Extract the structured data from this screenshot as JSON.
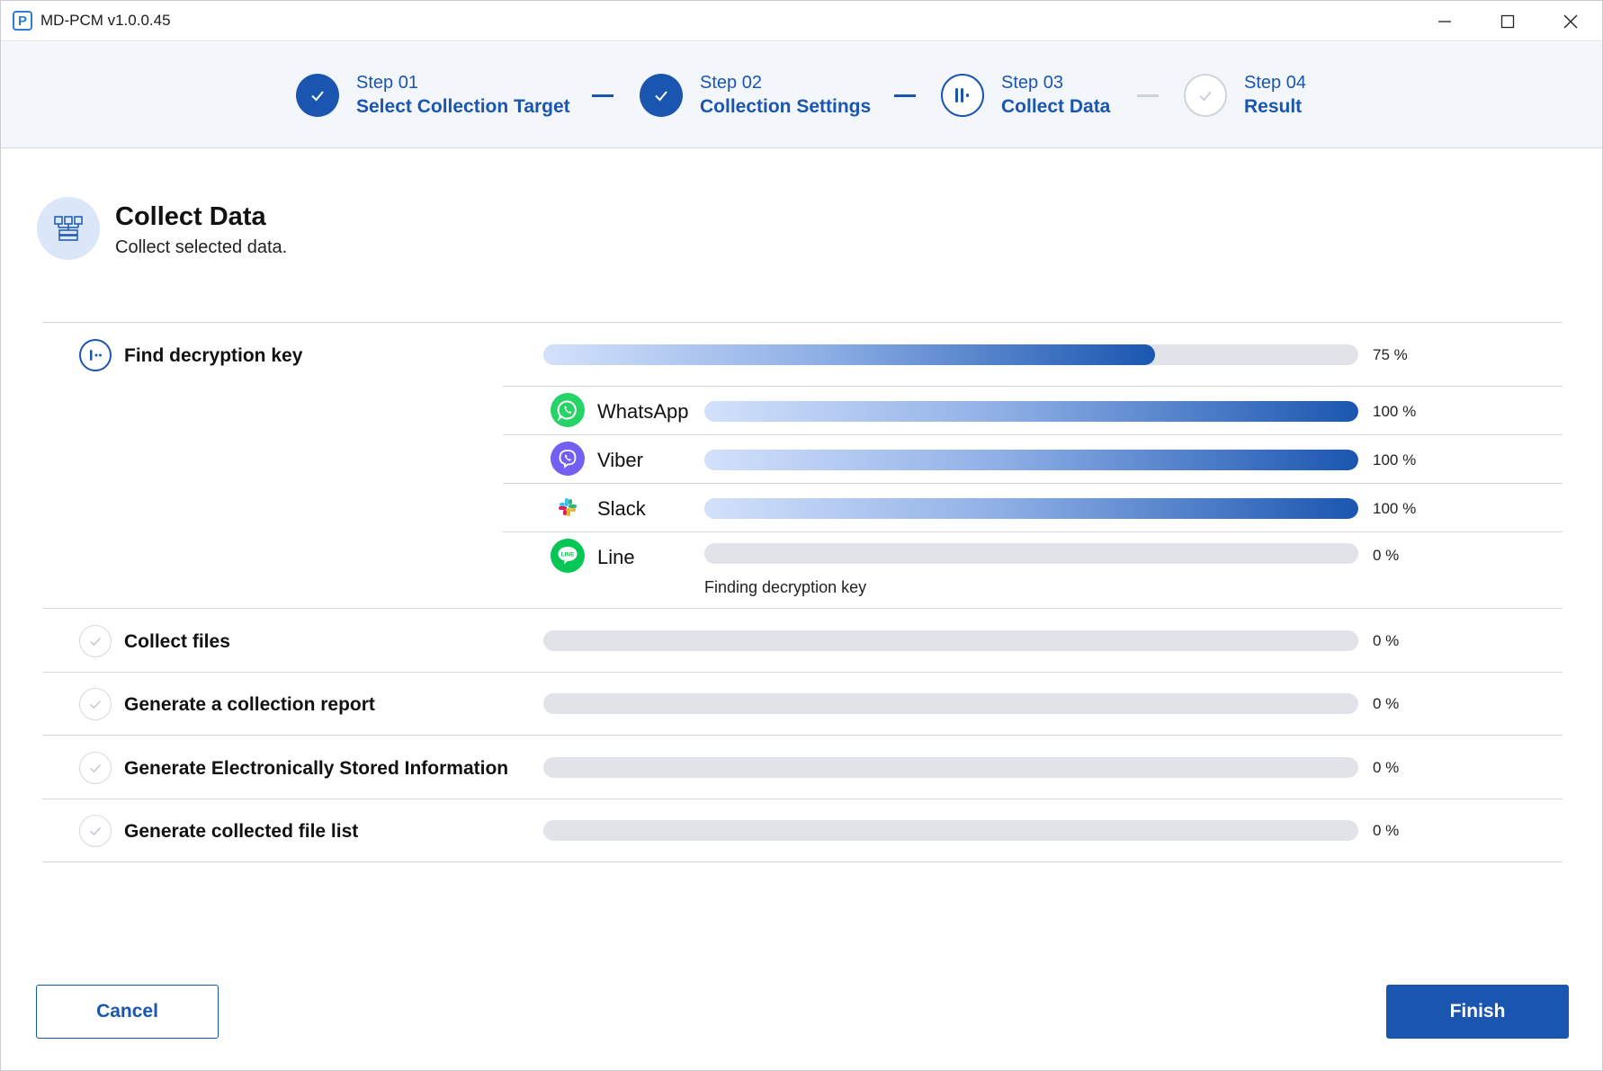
{
  "window": {
    "icon_letter": "P",
    "title": "MD-PCM v1.0.0.45"
  },
  "steps": [
    {
      "num": "Step 01",
      "name": "Select Collection Target",
      "state": "done"
    },
    {
      "num": "Step 02",
      "name": "Collection Settings",
      "state": "done"
    },
    {
      "num": "Step 03",
      "name": "Collect Data",
      "state": "active"
    },
    {
      "num": "Step 04",
      "name": "Result",
      "state": "pending"
    }
  ],
  "header": {
    "title": "Collect Data",
    "subtitle": "Collect selected data."
  },
  "tasks": {
    "find_key": {
      "label": "Find decryption key",
      "progress": 75,
      "pct_text": "75 %",
      "icon": "in-progress-icon"
    },
    "collect_files": {
      "label": "Collect files",
      "progress": 0,
      "pct_text": "0 %",
      "icon": "check-icon"
    },
    "report": {
      "label": "Generate a collection report",
      "progress": 0,
      "pct_text": "0 %",
      "icon": "check-icon"
    },
    "esi": {
      "label": "Generate Electronically Stored Information",
      "progress": 0,
      "pct_text": "0 %",
      "icon": "check-icon"
    },
    "file_list": {
      "label": "Generate collected file list",
      "progress": 0,
      "pct_text": "0 %",
      "icon": "check-icon"
    }
  },
  "apps": {
    "whatsapp": {
      "name": "WhatsApp",
      "progress": 100,
      "pct_text": "100 %",
      "color": "#25d366"
    },
    "viber": {
      "name": "Viber",
      "progress": 100,
      "pct_text": "100 %",
      "color": "#7360f2"
    },
    "slack": {
      "name": "Slack",
      "progress": 100,
      "pct_text": "100 %",
      "color": "#e01e5a"
    },
    "line": {
      "name": "Line",
      "progress": 0,
      "pct_text": "0 %",
      "color": "#06c755",
      "logo_text": "LINE",
      "status": "Finding decryption key"
    }
  },
  "buttons": {
    "cancel": "Cancel",
    "finish": "Finish"
  },
  "colors": {
    "accent": "#1a56b0",
    "track": "#e1e3e8"
  }
}
